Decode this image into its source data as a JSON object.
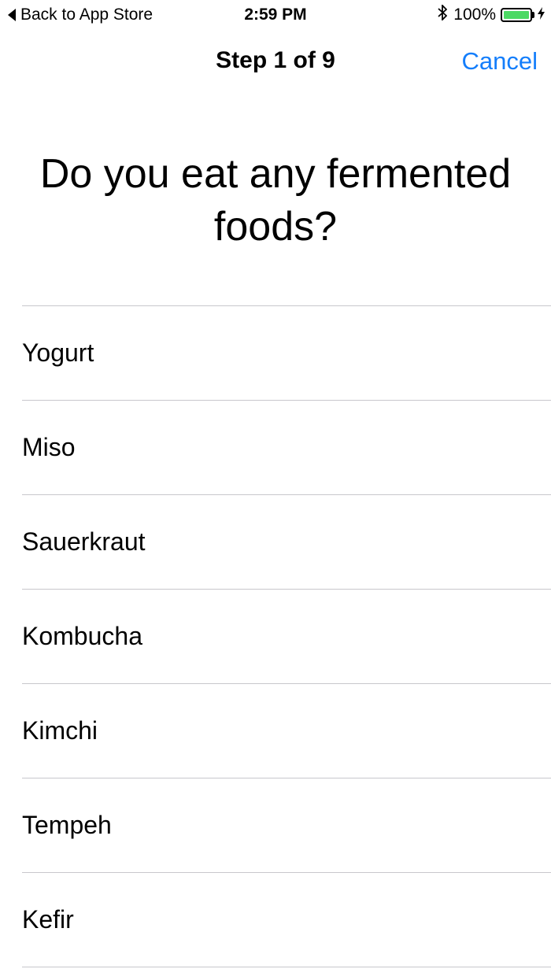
{
  "status_bar": {
    "back_label": "Back to App Store",
    "time": "2:59 PM",
    "battery_text": "100%",
    "battery_level": 1.0,
    "bluetooth_icon": "bluetooth-icon",
    "charging_icon": "bolt-icon",
    "battery_color": "#4cd964"
  },
  "nav": {
    "title": "Step 1 of 9",
    "cancel_label": "Cancel",
    "accent_color": "#147efb"
  },
  "question": "Do you eat any fermented foods?",
  "options": [
    {
      "label": "Yogurt"
    },
    {
      "label": "Miso"
    },
    {
      "label": "Sauerkraut"
    },
    {
      "label": "Kombucha"
    },
    {
      "label": "Kimchi"
    },
    {
      "label": "Tempeh"
    },
    {
      "label": "Kefir"
    }
  ]
}
